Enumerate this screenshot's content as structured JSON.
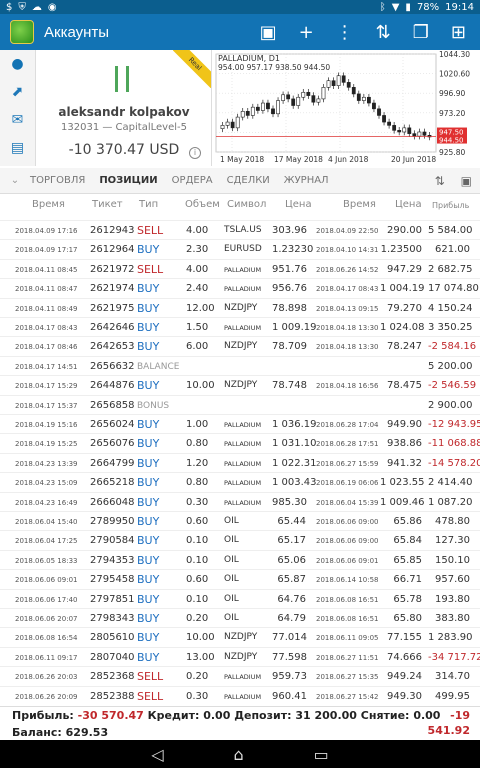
{
  "statusbar": {
    "battery": "78%",
    "time": "19:14"
  },
  "appbar": {
    "title": "Аккаунты"
  },
  "account": {
    "name": "aleksandr kolpakov",
    "server": "132031 — CapitalLevel-5",
    "balance": "-10 370.47 USD",
    "ribbon": "Real"
  },
  "chart": {
    "title": "PALLADIUM, D1",
    "values_line": "954.00 957.17 938.50 944.50",
    "current_price": "944.50",
    "current_price2": "947.50"
  },
  "chart_data": {
    "type": "candlestick",
    "title": "PALLADIUM, D1",
    "y_ticks": [
      "1044.30",
      "1020.60",
      "996.90",
      "973.20",
      "949.50",
      "925.80"
    ],
    "x_ticks": [
      "1 May 2018",
      "17 May 2018",
      "4 Jun 2018",
      "20 Jun 2018"
    ],
    "ylim": [
      925.8,
      1044.3
    ]
  },
  "tabs": [
    "ТОРГОВЛЯ",
    "ПОЗИЦИИ",
    "ОРДЕРА",
    "СДЕЛКИ",
    "ЖУРНАЛ"
  ],
  "columns": [
    "Время",
    "Тикет",
    "Тип",
    "Объем",
    "Символ",
    "Цена",
    "Время",
    "Цена",
    "Прибыль"
  ],
  "rows": [
    {
      "t1": "2018.04.09 17:16",
      "tk": "2612943",
      "ty": "SELL",
      "vol": "4.00",
      "sym": "TSLA.US",
      "p1": "303.96",
      "t2": "2018.04.09 22:50",
      "p2": "290.00",
      "pr": "5 584.00"
    },
    {
      "t1": "2018.04.09 17:17",
      "tk": "2612964",
      "ty": "BUY",
      "vol": "2.30",
      "sym": "EURUSD",
      "p1": "1.23230",
      "t2": "2018.04.10 14:31",
      "p2": "1.23500",
      "pr": "621.00"
    },
    {
      "t1": "2018.04.11 08:45",
      "tk": "2621972",
      "ty": "SELL",
      "vol": "4.00",
      "sym": "PALLADIUM",
      "p1": "951.76",
      "t2": "2018.06.26 14:52",
      "p2": "947.29",
      "pr": "2 682.75"
    },
    {
      "t1": "2018.04.11 08:47",
      "tk": "2621974",
      "ty": "BUY",
      "vol": "2.40",
      "sym": "PALLADIUM",
      "p1": "956.76",
      "t2": "2018.04.17 08:43",
      "p2": "1 004.19",
      "pr": "17 074.80"
    },
    {
      "t1": "2018.04.11 08:49",
      "tk": "2621975",
      "ty": "BUY",
      "vol": "12.00",
      "sym": "NZDJPY",
      "p1": "78.898",
      "t2": "2018.04.13 09:15",
      "p2": "79.270",
      "pr": "4 150.24"
    },
    {
      "t1": "2018.04.17 08:43",
      "tk": "2642646",
      "ty": "BUY",
      "vol": "1.50",
      "sym": "PALLADIUM",
      "p1": "1 009.19",
      "t2": "2018.04.18 13:30",
      "p2": "1 024.08",
      "pr": "3 350.25"
    },
    {
      "t1": "2018.04.17 08:46",
      "tk": "2642653",
      "ty": "BUY",
      "vol": "6.00",
      "sym": "NZDJPY",
      "p1": "78.709",
      "t2": "2018.04.18 13:30",
      "p2": "78.247",
      "pr": "-2 584.16"
    },
    {
      "t1": "2018.04.17 14:51",
      "tk": "2656632",
      "ty": "BALANCE",
      "vol": "",
      "sym": "",
      "p1": "",
      "t2": "",
      "p2": "",
      "pr": "5 200.00"
    },
    {
      "t1": "2018.04.17 15:29",
      "tk": "2644876",
      "ty": "BUY",
      "vol": "10.00",
      "sym": "NZDJPY",
      "p1": "78.748",
      "t2": "2018.04.18 16:56",
      "p2": "78.475",
      "pr": "-2 546.59"
    },
    {
      "t1": "2018.04.17 15:37",
      "tk": "2656858",
      "ty": "BONUS",
      "vol": "",
      "sym": "",
      "p1": "",
      "t2": "",
      "p2": "",
      "pr": "2 900.00"
    },
    {
      "t1": "2018.04.19 15:16",
      "tk": "2656024",
      "ty": "BUY",
      "vol": "1.00",
      "sym": "PALLADIUM",
      "p1": "1 036.19",
      "t2": "2018.06.28 17:04",
      "p2": "949.90",
      "pr": "-12 943.95"
    },
    {
      "t1": "2018.04.19 15:25",
      "tk": "2656076",
      "ty": "BUY",
      "vol": "0.80",
      "sym": "PALLADIUM",
      "p1": "1 031.10",
      "t2": "2018.06.28 17:51",
      "p2": "938.86",
      "pr": "-11 068.88"
    },
    {
      "t1": "2018.04.23 13:39",
      "tk": "2664799",
      "ty": "BUY",
      "vol": "1.20",
      "sym": "PALLADIUM",
      "p1": "1 022.31",
      "t2": "2018.06.27 15:59",
      "p2": "941.32",
      "pr": "-14 578.20"
    },
    {
      "t1": "2018.04.23 15:09",
      "tk": "2665218",
      "ty": "BUY",
      "vol": "0.80",
      "sym": "PALLADIUM",
      "p1": "1 003.43",
      "t2": "2018.06.19 06:06",
      "p2": "1 023.55",
      "pr": "2 414.40"
    },
    {
      "t1": "2018.04.23 16:49",
      "tk": "2666048",
      "ty": "BUY",
      "vol": "0.30",
      "sym": "PALLADIUM",
      "p1": "985.30",
      "t2": "2018.06.04 15:39",
      "p2": "1 009.46",
      "pr": "1 087.20"
    },
    {
      "t1": "2018.06.04 15:40",
      "tk": "2789950",
      "ty": "BUY",
      "vol": "0.60",
      "sym": "OIL",
      "p1": "65.44",
      "t2": "2018.06.06 09:00",
      "p2": "65.86",
      "pr": "478.80"
    },
    {
      "t1": "2018.06.04 17:25",
      "tk": "2790584",
      "ty": "BUY",
      "vol": "0.10",
      "sym": "OIL",
      "p1": "65.17",
      "t2": "2018.06.06 09:00",
      "p2": "65.84",
      "pr": "127.30"
    },
    {
      "t1": "2018.06.05 18:33",
      "tk": "2794353",
      "ty": "BUY",
      "vol": "0.10",
      "sym": "OIL",
      "p1": "65.06",
      "t2": "2018.06.06 09:01",
      "p2": "65.85",
      "pr": "150.10"
    },
    {
      "t1": "2018.06.06 09:01",
      "tk": "2795458",
      "ty": "BUY",
      "vol": "0.60",
      "sym": "OIL",
      "p1": "65.87",
      "t2": "2018.06.14 10:58",
      "p2": "66.71",
      "pr": "957.60"
    },
    {
      "t1": "2018.06.06 17:40",
      "tk": "2797851",
      "ty": "BUY",
      "vol": "0.10",
      "sym": "OIL",
      "p1": "64.76",
      "t2": "2018.06.08 16:51",
      "p2": "65.78",
      "pr": "193.80"
    },
    {
      "t1": "2018.06.06 20:07",
      "tk": "2798343",
      "ty": "BUY",
      "vol": "0.20",
      "sym": "OIL",
      "p1": "64.79",
      "t2": "2018.06.08 16:51",
      "p2": "65.80",
      "pr": "383.80"
    },
    {
      "t1": "2018.06.08 16:54",
      "tk": "2805610",
      "ty": "BUY",
      "vol": "10.00",
      "sym": "NZDJPY",
      "p1": "77.014",
      "t2": "2018.06.11 09:05",
      "p2": "77.155",
      "pr": "1 283.90"
    },
    {
      "t1": "2018.06.11 09:17",
      "tk": "2807040",
      "ty": "BUY",
      "vol": "13.00",
      "sym": "NZDJPY",
      "p1": "77.598",
      "t2": "2018.06.27 11:51",
      "p2": "74.666",
      "pr": "-34 717.72"
    },
    {
      "t1": "2018.06.26 20:03",
      "tk": "2852368",
      "ty": "SELL",
      "vol": "0.20",
      "sym": "PALLADIUM",
      "p1": "959.73",
      "t2": "2018.06.27 15:35",
      "p2": "949.24",
      "pr": "314.70"
    },
    {
      "t1": "2018.06.26 20:09",
      "tk": "2852388",
      "ty": "SELL",
      "vol": "0.30",
      "sym": "PALLADIUM",
      "p1": "960.41",
      "t2": "2018.06.27 15:42",
      "p2": "949.30",
      "pr": "499.95"
    }
  ],
  "summary": {
    "profit_label": "Прибыль:",
    "profit": "-30 570.47",
    "credit_label": "Кредит:",
    "credit": "0.00",
    "deposit_label": "Депозит:",
    "deposit": "31 200.00",
    "withdraw_label": "Снятие:",
    "withdraw": "0.00",
    "balance_label": "Баланс:",
    "balance": "629.53",
    "right1": "-19",
    "right2": "541.92"
  }
}
